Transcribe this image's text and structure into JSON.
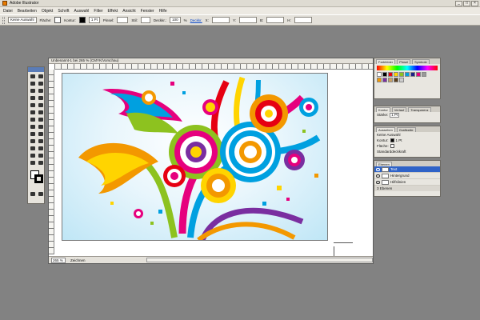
{
  "window": {
    "title": "Adobe Illustrator"
  },
  "menubar": [
    "Datei",
    "Bearbeiten",
    "Objekt",
    "Schrift",
    "Auswahl",
    "Filter",
    "Effekt",
    "Ansicht",
    "Fenster",
    "Hilfe"
  ],
  "controlbar": {
    "selection": "Keine Auswahl",
    "fill_label": "Fläche:",
    "stroke_label": "Kontur:",
    "stroke_weight": "1 Pt",
    "brush_label": "Pinsel:",
    "style_label": "Stil:",
    "opacity_label": "Deckkr.:",
    "opacity_value": "100",
    "opacity_unit": "%",
    "link": "Deckkr.",
    "x_label": "X:",
    "y_label": "Y:",
    "w_label": "B:",
    "h_label": "H:"
  },
  "document": {
    "title": "Unbenannt-1 bei 265 % (CMYK/Vorschau)",
    "zoom": "265 %",
    "status": "Zeichnen"
  },
  "swatch_panel": {
    "tabs": [
      "Farbfelder",
      "Pinsel",
      "Symbole"
    ]
  },
  "stroke_panel": {
    "tabs": [
      "Kontur",
      "Verlauf",
      "Transparenz"
    ],
    "weight_label": "Stärke:",
    "weight_value": "1 Pt"
  },
  "appearance_panel": {
    "tabs": [
      "Aussehen",
      "Grafikstile"
    ],
    "selection": "Keine Auswahl",
    "stroke_label": "Kontur:",
    "stroke_value": "1 Pt",
    "fill_label": "Fläche:",
    "opacity": "Standarddeckkraft"
  },
  "layers_panel": {
    "tabs": [
      "Ebenen"
    ],
    "layers": [
      "Text",
      "Hintergrund",
      "Hilfslinien"
    ],
    "footer": "3 Ebenen"
  },
  "colors": {
    "selection": "#2f63c7"
  }
}
